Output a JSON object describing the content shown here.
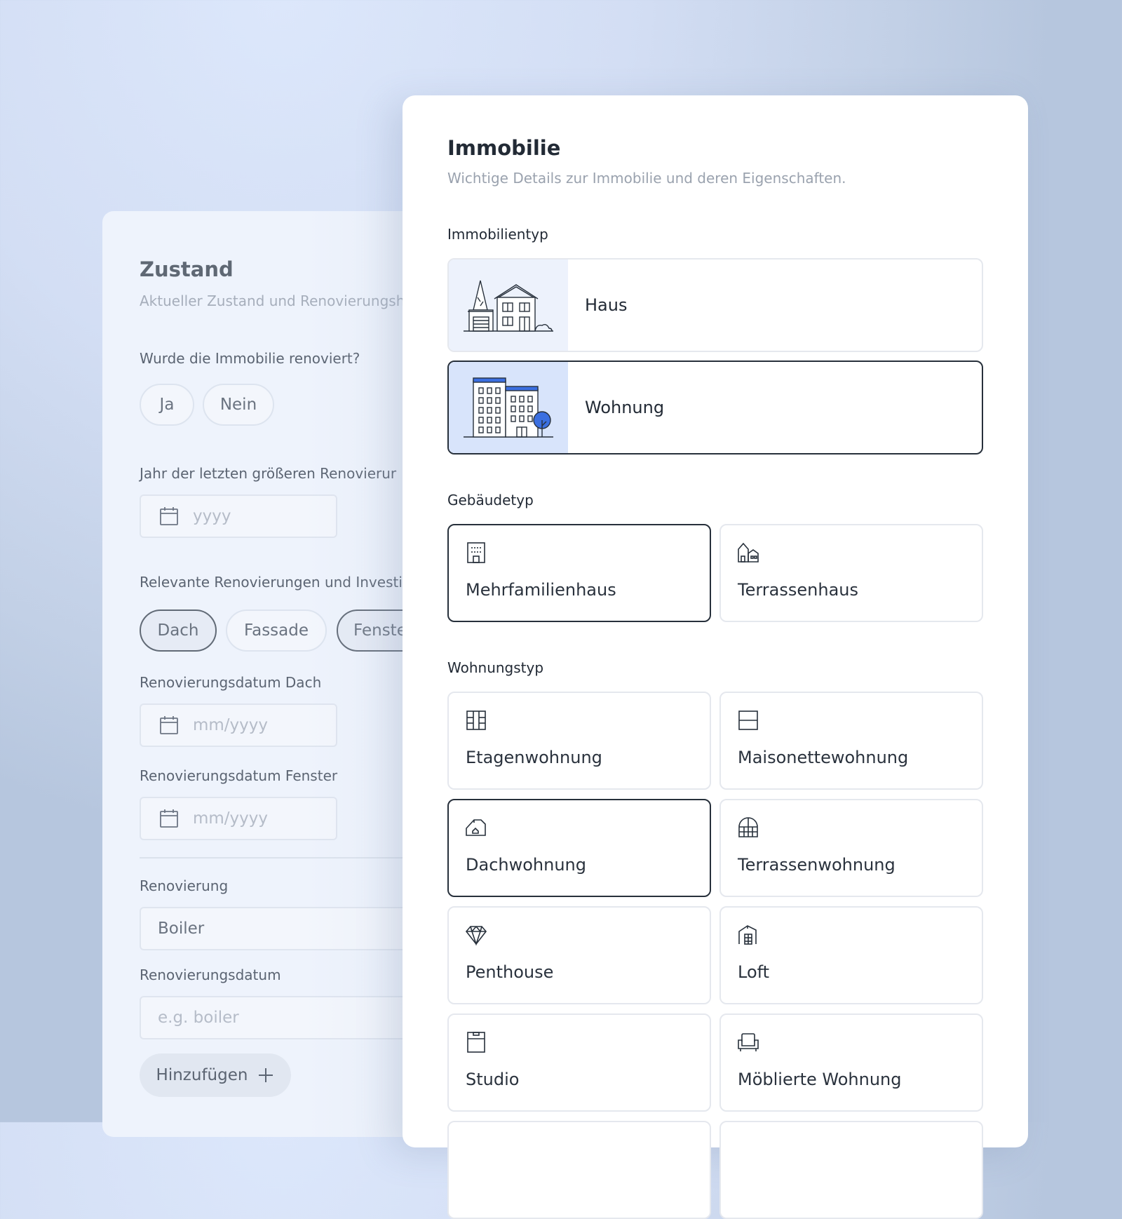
{
  "condition_panel": {
    "title": "Zustand",
    "subtitle": "Aktueller Zustand und Renovierungsh",
    "renovated_question": "Wurde die Immobilie renoviert?",
    "renovated_options": [
      "Ja",
      "Nein"
    ],
    "last_renovation_label": "Jahr der letzten größeren Renovierur",
    "last_renovation_placeholder": "yyyy",
    "relevant_label": "Relevante Renovierungen und Investi",
    "relevant_options": [
      {
        "label": "Dach",
        "active": true
      },
      {
        "label": "Fassade",
        "active": false
      },
      {
        "label": "Fenste",
        "active": true
      }
    ],
    "date_roof_label": "Renovierungsdatum Dach",
    "date_roof_placeholder": "mm/yyyy",
    "date_window_label": "Renovierungsdatum Fenster",
    "date_window_placeholder": "mm/yyyy",
    "renovation_label": "Renovierung",
    "renovation_value": "Boiler",
    "renovation_date_label": "Renovierungsdatum",
    "renovation_date_placeholder": "e.g. boiler",
    "add_button": "Hinzufügen"
  },
  "property_panel": {
    "title": "Immobilie",
    "subtitle": "Wichtige Details zur Immobilie und deren Eigenschaften.",
    "property_type_label": "Immobilientyp",
    "property_types": [
      {
        "label": "Haus",
        "icon": "house-illustration",
        "selected": false
      },
      {
        "label": "Wohnung",
        "icon": "apartment-building-illustration",
        "selected": true
      }
    ],
    "building_type_label": "Gebäudetyp",
    "building_types": [
      {
        "label": "Mehrfamilienhaus",
        "icon": "multi-family-building-icon",
        "selected": true
      },
      {
        "label": "Terrassenhaus",
        "icon": "terraced-house-icon",
        "selected": false
      }
    ],
    "apartment_type_label": "Wohnungstyp",
    "apartment_types": [
      {
        "label": "Etagenwohnung",
        "icon": "floor-plan-icon",
        "selected": false
      },
      {
        "label": "Maisonettewohnung",
        "icon": "maisonette-icon",
        "selected": false
      },
      {
        "label": "Dachwohnung",
        "icon": "attic-icon",
        "selected": true
      },
      {
        "label": "Terrassenwohnung",
        "icon": "terrace-window-icon",
        "selected": false
      },
      {
        "label": "Penthouse",
        "icon": "diamond-icon",
        "selected": false
      },
      {
        "label": "Loft",
        "icon": "loft-icon",
        "selected": false
      },
      {
        "label": "Studio",
        "icon": "studio-door-icon",
        "selected": false
      },
      {
        "label": "Möblierte Wohnung",
        "icon": "armchair-icon",
        "selected": false
      }
    ]
  },
  "colors": {
    "accent_blue": "#3b6fe0",
    "selected_border": "#27303b",
    "background": "#d3def4"
  }
}
